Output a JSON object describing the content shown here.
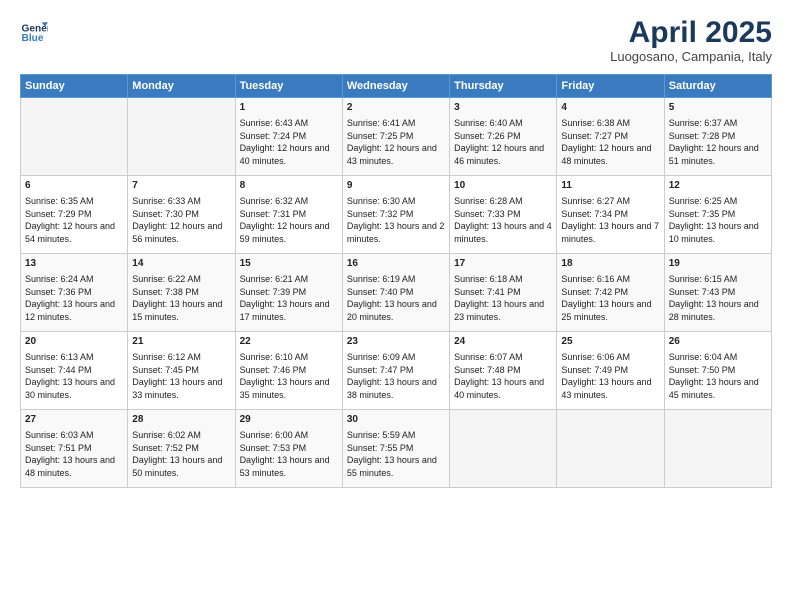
{
  "header": {
    "logo_line1": "General",
    "logo_line2": "Blue",
    "title": "April 2025",
    "location": "Luogosano, Campania, Italy"
  },
  "columns": [
    "Sunday",
    "Monday",
    "Tuesday",
    "Wednesday",
    "Thursday",
    "Friday",
    "Saturday"
  ],
  "weeks": [
    [
      {
        "day": "",
        "sunrise": "",
        "sunset": "",
        "daylight": ""
      },
      {
        "day": "",
        "sunrise": "",
        "sunset": "",
        "daylight": ""
      },
      {
        "day": "1",
        "sunrise": "Sunrise: 6:43 AM",
        "sunset": "Sunset: 7:24 PM",
        "daylight": "Daylight: 12 hours and 40 minutes."
      },
      {
        "day": "2",
        "sunrise": "Sunrise: 6:41 AM",
        "sunset": "Sunset: 7:25 PM",
        "daylight": "Daylight: 12 hours and 43 minutes."
      },
      {
        "day": "3",
        "sunrise": "Sunrise: 6:40 AM",
        "sunset": "Sunset: 7:26 PM",
        "daylight": "Daylight: 12 hours and 46 minutes."
      },
      {
        "day": "4",
        "sunrise": "Sunrise: 6:38 AM",
        "sunset": "Sunset: 7:27 PM",
        "daylight": "Daylight: 12 hours and 48 minutes."
      },
      {
        "day": "5",
        "sunrise": "Sunrise: 6:37 AM",
        "sunset": "Sunset: 7:28 PM",
        "daylight": "Daylight: 12 hours and 51 minutes."
      }
    ],
    [
      {
        "day": "6",
        "sunrise": "Sunrise: 6:35 AM",
        "sunset": "Sunset: 7:29 PM",
        "daylight": "Daylight: 12 hours and 54 minutes."
      },
      {
        "day": "7",
        "sunrise": "Sunrise: 6:33 AM",
        "sunset": "Sunset: 7:30 PM",
        "daylight": "Daylight: 12 hours and 56 minutes."
      },
      {
        "day": "8",
        "sunrise": "Sunrise: 6:32 AM",
        "sunset": "Sunset: 7:31 PM",
        "daylight": "Daylight: 12 hours and 59 minutes."
      },
      {
        "day": "9",
        "sunrise": "Sunrise: 6:30 AM",
        "sunset": "Sunset: 7:32 PM",
        "daylight": "Daylight: 13 hours and 2 minutes."
      },
      {
        "day": "10",
        "sunrise": "Sunrise: 6:28 AM",
        "sunset": "Sunset: 7:33 PM",
        "daylight": "Daylight: 13 hours and 4 minutes."
      },
      {
        "day": "11",
        "sunrise": "Sunrise: 6:27 AM",
        "sunset": "Sunset: 7:34 PM",
        "daylight": "Daylight: 13 hours and 7 minutes."
      },
      {
        "day": "12",
        "sunrise": "Sunrise: 6:25 AM",
        "sunset": "Sunset: 7:35 PM",
        "daylight": "Daylight: 13 hours and 10 minutes."
      }
    ],
    [
      {
        "day": "13",
        "sunrise": "Sunrise: 6:24 AM",
        "sunset": "Sunset: 7:36 PM",
        "daylight": "Daylight: 13 hours and 12 minutes."
      },
      {
        "day": "14",
        "sunrise": "Sunrise: 6:22 AM",
        "sunset": "Sunset: 7:38 PM",
        "daylight": "Daylight: 13 hours and 15 minutes."
      },
      {
        "day": "15",
        "sunrise": "Sunrise: 6:21 AM",
        "sunset": "Sunset: 7:39 PM",
        "daylight": "Daylight: 13 hours and 17 minutes."
      },
      {
        "day": "16",
        "sunrise": "Sunrise: 6:19 AM",
        "sunset": "Sunset: 7:40 PM",
        "daylight": "Daylight: 13 hours and 20 minutes."
      },
      {
        "day": "17",
        "sunrise": "Sunrise: 6:18 AM",
        "sunset": "Sunset: 7:41 PM",
        "daylight": "Daylight: 13 hours and 23 minutes."
      },
      {
        "day": "18",
        "sunrise": "Sunrise: 6:16 AM",
        "sunset": "Sunset: 7:42 PM",
        "daylight": "Daylight: 13 hours and 25 minutes."
      },
      {
        "day": "19",
        "sunrise": "Sunrise: 6:15 AM",
        "sunset": "Sunset: 7:43 PM",
        "daylight": "Daylight: 13 hours and 28 minutes."
      }
    ],
    [
      {
        "day": "20",
        "sunrise": "Sunrise: 6:13 AM",
        "sunset": "Sunset: 7:44 PM",
        "daylight": "Daylight: 13 hours and 30 minutes."
      },
      {
        "day": "21",
        "sunrise": "Sunrise: 6:12 AM",
        "sunset": "Sunset: 7:45 PM",
        "daylight": "Daylight: 13 hours and 33 minutes."
      },
      {
        "day": "22",
        "sunrise": "Sunrise: 6:10 AM",
        "sunset": "Sunset: 7:46 PM",
        "daylight": "Daylight: 13 hours and 35 minutes."
      },
      {
        "day": "23",
        "sunrise": "Sunrise: 6:09 AM",
        "sunset": "Sunset: 7:47 PM",
        "daylight": "Daylight: 13 hours and 38 minutes."
      },
      {
        "day": "24",
        "sunrise": "Sunrise: 6:07 AM",
        "sunset": "Sunset: 7:48 PM",
        "daylight": "Daylight: 13 hours and 40 minutes."
      },
      {
        "day": "25",
        "sunrise": "Sunrise: 6:06 AM",
        "sunset": "Sunset: 7:49 PM",
        "daylight": "Daylight: 13 hours and 43 minutes."
      },
      {
        "day": "26",
        "sunrise": "Sunrise: 6:04 AM",
        "sunset": "Sunset: 7:50 PM",
        "daylight": "Daylight: 13 hours and 45 minutes."
      }
    ],
    [
      {
        "day": "27",
        "sunrise": "Sunrise: 6:03 AM",
        "sunset": "Sunset: 7:51 PM",
        "daylight": "Daylight: 13 hours and 48 minutes."
      },
      {
        "day": "28",
        "sunrise": "Sunrise: 6:02 AM",
        "sunset": "Sunset: 7:52 PM",
        "daylight": "Daylight: 13 hours and 50 minutes."
      },
      {
        "day": "29",
        "sunrise": "Sunrise: 6:00 AM",
        "sunset": "Sunset: 7:53 PM",
        "daylight": "Daylight: 13 hours and 53 minutes."
      },
      {
        "day": "30",
        "sunrise": "Sunrise: 5:59 AM",
        "sunset": "Sunset: 7:55 PM",
        "daylight": "Daylight: 13 hours and 55 minutes."
      },
      {
        "day": "",
        "sunrise": "",
        "sunset": "",
        "daylight": ""
      },
      {
        "day": "",
        "sunrise": "",
        "sunset": "",
        "daylight": ""
      },
      {
        "day": "",
        "sunrise": "",
        "sunset": "",
        "daylight": ""
      }
    ]
  ]
}
